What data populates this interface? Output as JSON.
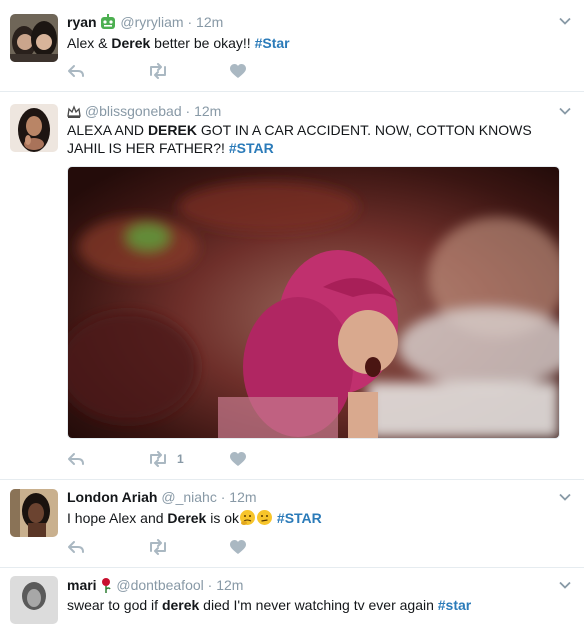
{
  "tweets": [
    {
      "name": "ryan",
      "handle": "@ryryliam",
      "dot": "·",
      "time": "12m",
      "text_parts": [
        "Alex & ",
        "Derek",
        " better be okay!! ",
        "#Star"
      ],
      "icon_after_name": "robot-emoji-icon"
    },
    {
      "name": "",
      "handle": "@blissgonebad",
      "dot": "·",
      "time": "12m",
      "text_parts": [
        "ALEXA AND ",
        "DEREK",
        " GOT IN A CAR ACCIDENT. NOW, COTTON KNOWS JAHIL IS HER FATHER?! ",
        "#STAR"
      ],
      "icon_before_handle": "crown-icon",
      "retweet_count": "1"
    },
    {
      "name": "London Ariah",
      "handle": "@_niahc",
      "dot": "·",
      "time": "12m",
      "text_parts": [
        "I hope Alex and ",
        "Derek",
        " is ok",
        "#STAR"
      ]
    },
    {
      "name": "mari",
      "handle": "@dontbeafool",
      "dot": "·",
      "time": "12m",
      "text_parts": [
        "swear to god if ",
        "derek",
        " died I'm never watching tv ever again ",
        "#star"
      ],
      "icon_after_name": "rose-icon"
    }
  ],
  "colors": {
    "hashtag": "#2b7bb9",
    "meta": "#8899a6",
    "icon": "#aab8c2",
    "divider": "#e6ecf0"
  }
}
